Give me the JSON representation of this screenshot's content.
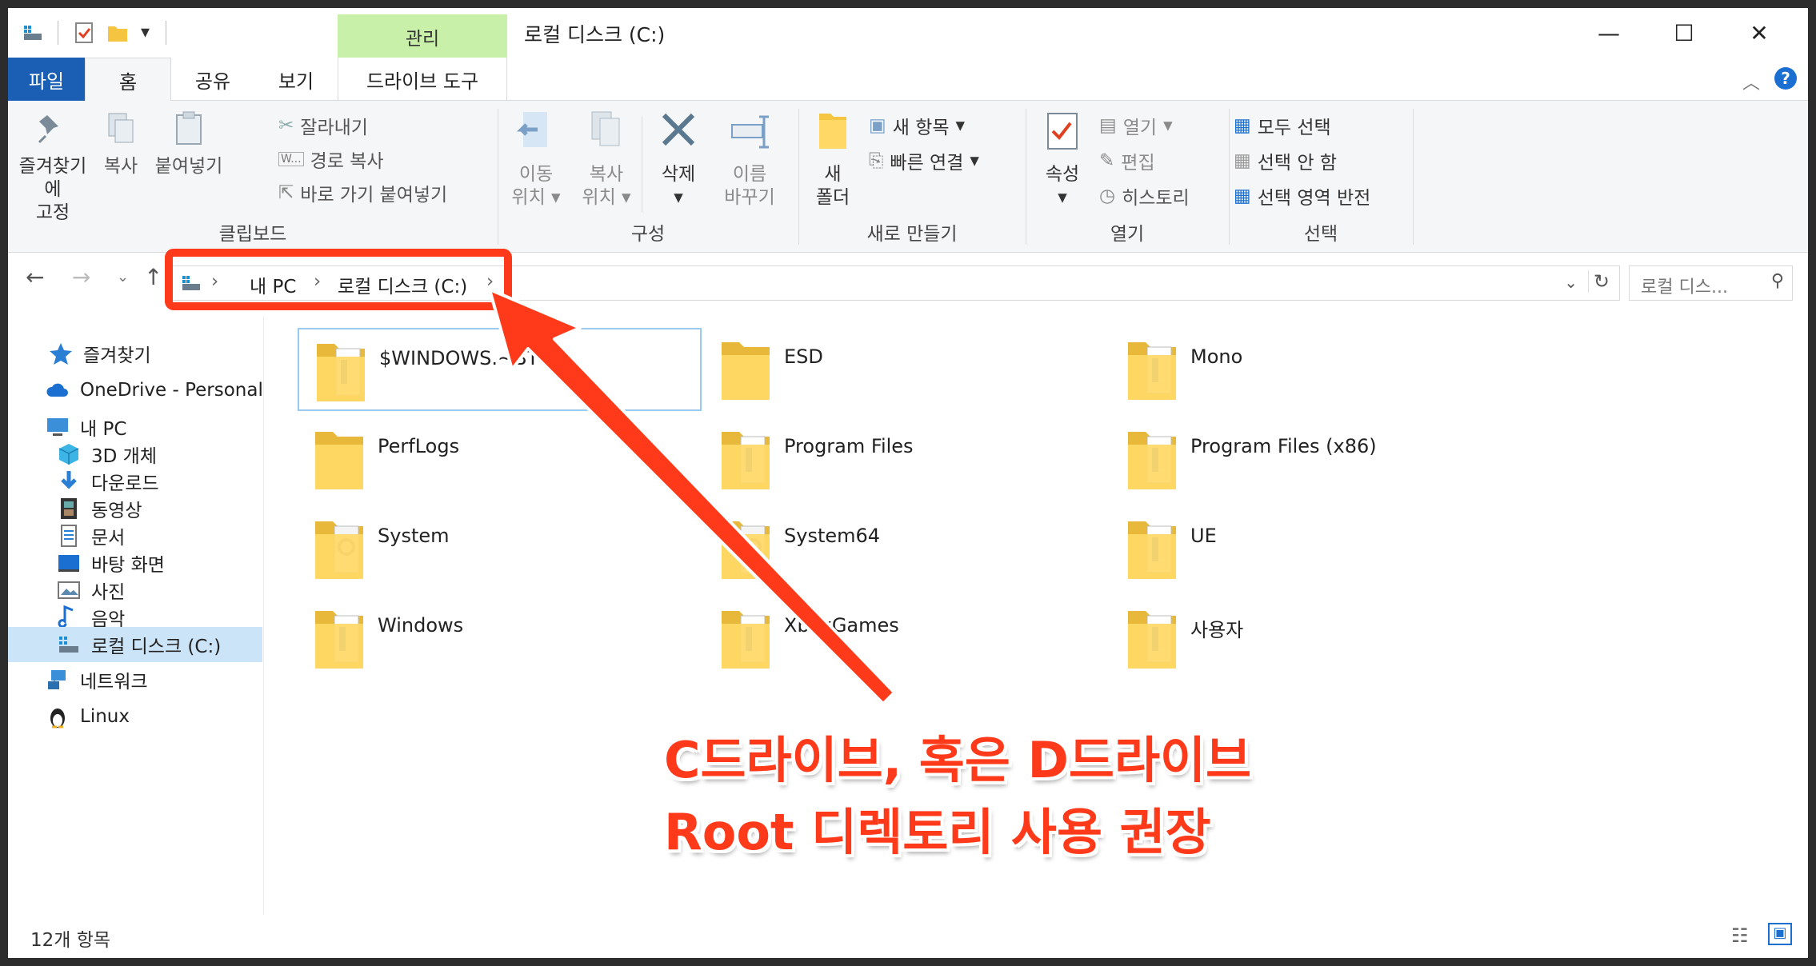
{
  "window": {
    "title": "로컬 디스크 (C:)",
    "context_tab": "관리",
    "controls": {
      "minimize": "—",
      "maximize": "☐",
      "close": "✕"
    }
  },
  "tabs": [
    {
      "label": "파일"
    },
    {
      "label": "홈"
    },
    {
      "label": "공유"
    },
    {
      "label": "보기"
    },
    {
      "label": "드라이브 도구"
    }
  ],
  "ribbon": {
    "clipboard": {
      "group": "클립보드",
      "pin_line1": "즐겨찾기에",
      "pin_line2": "고정",
      "copy": "복사",
      "paste": "붙여넣기",
      "cut": "잘라내기",
      "copy_path": "경로 복사",
      "paste_shortcut": "바로 가기 붙여넣기"
    },
    "organize": {
      "group": "구성",
      "move_line1": "이동",
      "move_line2": "위치",
      "copyto_line1": "복사",
      "copyto_line2": "위치",
      "delete": "삭제",
      "rename_line1": "이름",
      "rename_line2": "바꾸기"
    },
    "new": {
      "group": "새로 만들기",
      "folder_line1": "새",
      "folder_line2": "폴더",
      "new_item": "새 항목",
      "easy_access": "빠른 연결"
    },
    "open": {
      "group": "열기",
      "properties": "속성",
      "open": "열기",
      "edit": "편집",
      "history": "히스토리"
    },
    "select": {
      "group": "선택",
      "select_all": "모두 선택",
      "select_none": "선택 안 함",
      "invert": "선택 영역 반전"
    }
  },
  "address": {
    "crumbs": [
      "내 PC",
      "로컬 디스크 (C:)"
    ],
    "search_placeholder": "로컬 디스..."
  },
  "nav": {
    "items": [
      {
        "label": "즐겨찾기",
        "icon": "star-icon"
      },
      {
        "label": "OneDrive - Personal",
        "icon": "cloud-icon"
      },
      {
        "label": "내 PC",
        "icon": "pc-icon"
      },
      {
        "label": "3D 개체",
        "icon": "cube-icon"
      },
      {
        "label": "다운로드",
        "icon": "download-icon"
      },
      {
        "label": "동영상",
        "icon": "film-icon"
      },
      {
        "label": "문서",
        "icon": "document-icon"
      },
      {
        "label": "바탕 화면",
        "icon": "desktop-icon"
      },
      {
        "label": "사진",
        "icon": "picture-icon"
      },
      {
        "label": "음악",
        "icon": "music-icon"
      },
      {
        "label": "로컬 디스크 (C:)",
        "icon": "drive-icon"
      },
      {
        "label": "네트워크",
        "icon": "network-icon"
      },
      {
        "label": "Linux",
        "icon": "penguin-icon"
      }
    ]
  },
  "folders": [
    {
      "name": "$WINDOWS.~BT",
      "kind": "files"
    },
    {
      "name": "ESD",
      "kind": "plain"
    },
    {
      "name": "Mono",
      "kind": "files"
    },
    {
      "name": "PerfLogs",
      "kind": "plain"
    },
    {
      "name": "Program Files",
      "kind": "files"
    },
    {
      "name": "Program Files (x86)",
      "kind": "files"
    },
    {
      "name": "System",
      "kind": "gear"
    },
    {
      "name": "System64",
      "kind": "gear"
    },
    {
      "name": "UE",
      "kind": "files"
    },
    {
      "name": "Windows",
      "kind": "files"
    },
    {
      "name": "XboxGames",
      "kind": "files"
    },
    {
      "name": "사용자",
      "kind": "files"
    }
  ],
  "status": {
    "count": "12개 항목"
  },
  "annotation": {
    "line1": "C드라이브, 혹은 D드라이브",
    "line2": "Root 디렉토리 사용 권장",
    "color": "#ff3a1a"
  }
}
